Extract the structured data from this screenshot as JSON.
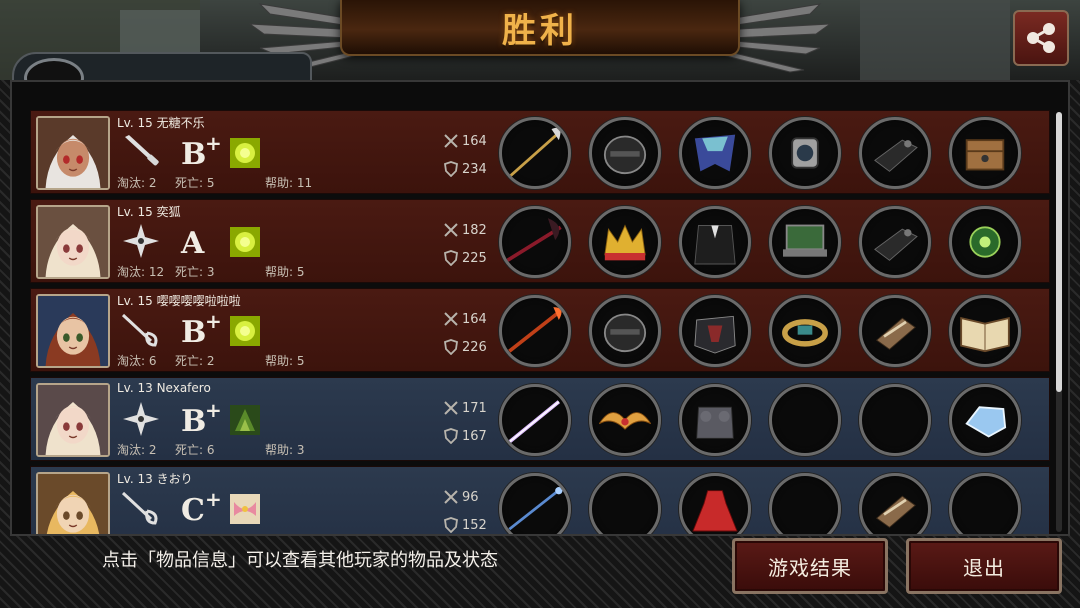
{
  "header": {
    "title": "胜利"
  },
  "share_icon": "share-icon",
  "players": [
    {
      "level": "Lv. 15",
      "name": "无糖不乐",
      "weapon_icon": "knife-icon",
      "rank_letter": "B",
      "rank_plus": "+",
      "skill_icon": "yellow-orb-skill-icon",
      "atk": "164",
      "def": "234",
      "kills_label": "淘汰: 2",
      "deaths_label": "死亡: 5",
      "assists_label": "帮助: 11",
      "row_color": "red",
      "items": [
        "glaive-weapon",
        "black-helmet",
        "blue-cape",
        "gear-watch",
        "black-gauntlet",
        "wooden-chest"
      ]
    },
    {
      "level": "Lv. 15",
      "name": "奕狐",
      "weapon_icon": "shuriken-icon",
      "rank_letter": "A",
      "rank_plus": "",
      "skill_icon": "yellow-orb-skill-icon",
      "atk": "182",
      "def": "225",
      "kills_label": "淘汰: 12",
      "deaths_label": "死亡: 3",
      "assists_label": "帮助: 5",
      "row_color": "red",
      "items": [
        "dark-scythe",
        "royal-crown",
        "black-suit",
        "laptop-device",
        "black-gauntlet",
        "green-orb-amulet"
      ]
    },
    {
      "level": "Lv. 15",
      "name": "嘤嘤嘤嘤啦啦啦",
      "weapon_icon": "rapier-icon",
      "rank_letter": "B",
      "rank_plus": "+",
      "skill_icon": "yellow-orb-skill-icon",
      "atk": "164",
      "def": "226",
      "kills_label": "淘汰: 6",
      "deaths_label": "死亡: 2",
      "assists_label": "帮助: 5",
      "row_color": "red",
      "items": [
        "flame-spear",
        "black-helmet",
        "dark-armor",
        "gold-bracelet",
        "bandaged-gauntlet",
        "open-book"
      ]
    },
    {
      "level": "Lv. 13",
      "name": "Nexafero",
      "weapon_icon": "shuriken-icon",
      "rank_letter": "B",
      "rank_plus": "+",
      "skill_icon": "green-forest-skill-icon",
      "atk": "171",
      "def": "167",
      "kills_label": "淘汰: 2",
      "deaths_label": "死亡: 6",
      "assists_label": "帮助: 3",
      "row_color": "blue",
      "items": [
        "laser-sword",
        "winged-tiara",
        "stone-armor",
        "empty",
        "empty",
        "ice-crystal"
      ]
    },
    {
      "level": "Lv. 13",
      "name": "きおり",
      "weapon_icon": "rapier-icon",
      "rank_letter": "C",
      "rank_plus": "+",
      "skill_icon": "pink-ribbon-skill-icon",
      "atk": "96",
      "def": "152",
      "kills_label": "",
      "deaths_label": "",
      "assists_label": "",
      "row_color": "blue",
      "items": [
        "blue-staff",
        "empty",
        "red-dress",
        "empty",
        "bandaged-gauntlet",
        "empty"
      ]
    }
  ],
  "footer": {
    "hint": "点击「物品信息」可以查看其他玩家的物品及状态",
    "result_button": "游戏结果",
    "exit_button": "退出"
  },
  "colors": {
    "title": "#f0b24a",
    "red_row": "#4a1a12",
    "blue_row": "#2c3a4e"
  }
}
